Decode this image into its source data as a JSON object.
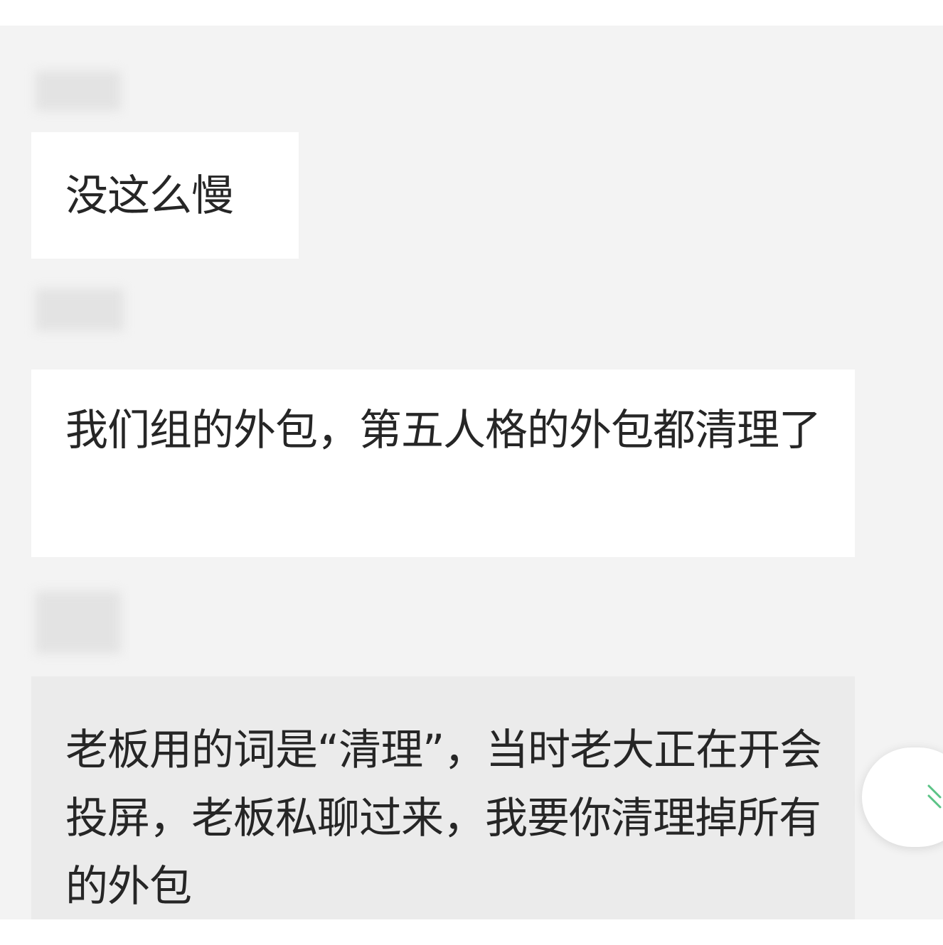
{
  "chat": {
    "messages": [
      {
        "text": "没这么慢"
      },
      {
        "text": "我们组的外包，第五人格的外包都清理了"
      },
      {
        "text": "老板用的词是“清理”，当时老大正在开会投屏，老板私聊过来，我要你清理掉所有的外包"
      }
    ]
  },
  "side_button": {
    "icon": "scroll-down-icon",
    "color": "#5bc386"
  }
}
